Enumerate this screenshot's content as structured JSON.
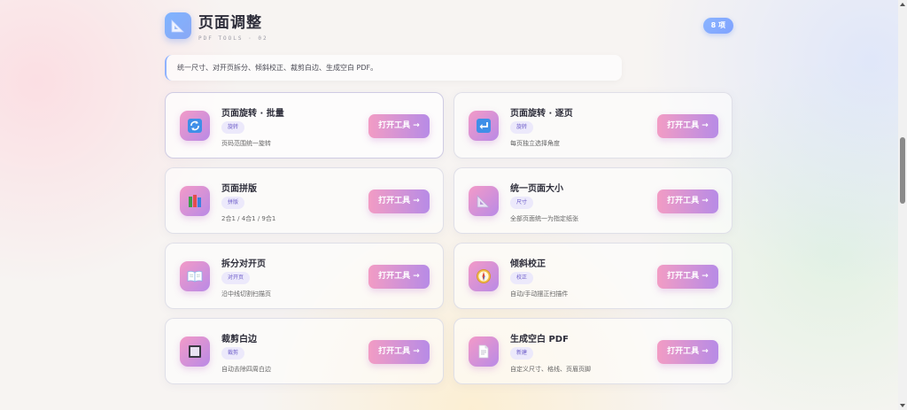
{
  "header": {
    "title": "页面调整",
    "subtitle": "PDF TOOLS · 02",
    "badge": "8 项",
    "icon": "triangle-ruler-icon"
  },
  "description": "统一尺寸、对开页拆分、倾斜校正、裁剪白边、生成空白 PDF。",
  "tools": [
    {
      "name": "页面旋转 · 批量",
      "tag": "旋转",
      "desc": "页码范围统一旋转",
      "button": "打开工具 →",
      "icon": "rotate-icon"
    },
    {
      "name": "页面旋转 · 逐页",
      "tag": "旋转",
      "desc": "每页独立选择角度",
      "button": "打开工具 →",
      "icon": "return-arrow-icon"
    },
    {
      "name": "页面拼版",
      "tag": "拼版",
      "desc": "2合1 / 4合1 / 9合1",
      "button": "打开工具 →",
      "icon": "books-icon"
    },
    {
      "name": "统一页面大小",
      "tag": "尺寸",
      "desc": "全部页面统一为指定纸张",
      "button": "打开工具 →",
      "icon": "triangle-ruler-icon"
    },
    {
      "name": "拆分对开页",
      "tag": "对开页",
      "desc": "沿中线切割扫描页",
      "button": "打开工具 →",
      "icon": "open-book-icon"
    },
    {
      "name": "倾斜校正",
      "tag": "校正",
      "desc": "自动/手动摆正扫描件",
      "button": "打开工具 →",
      "icon": "compass-icon"
    },
    {
      "name": "裁剪白边",
      "tag": "裁剪",
      "desc": "自动去除四周白边",
      "button": "打开工具 →",
      "icon": "square-frame-icon"
    },
    {
      "name": "生成空白 PDF",
      "tag": "新建",
      "desc": "自定义尺寸、格线、页眉页脚",
      "button": "打开工具 →",
      "icon": "document-icon"
    }
  ],
  "colors": {
    "accent_blue": "#8ab4ff",
    "button_gradient_start": "#f29cc4",
    "button_gradient_end": "#b78be6",
    "tag_bg": "#ece9fb",
    "tag_text": "#6b5bc8"
  }
}
